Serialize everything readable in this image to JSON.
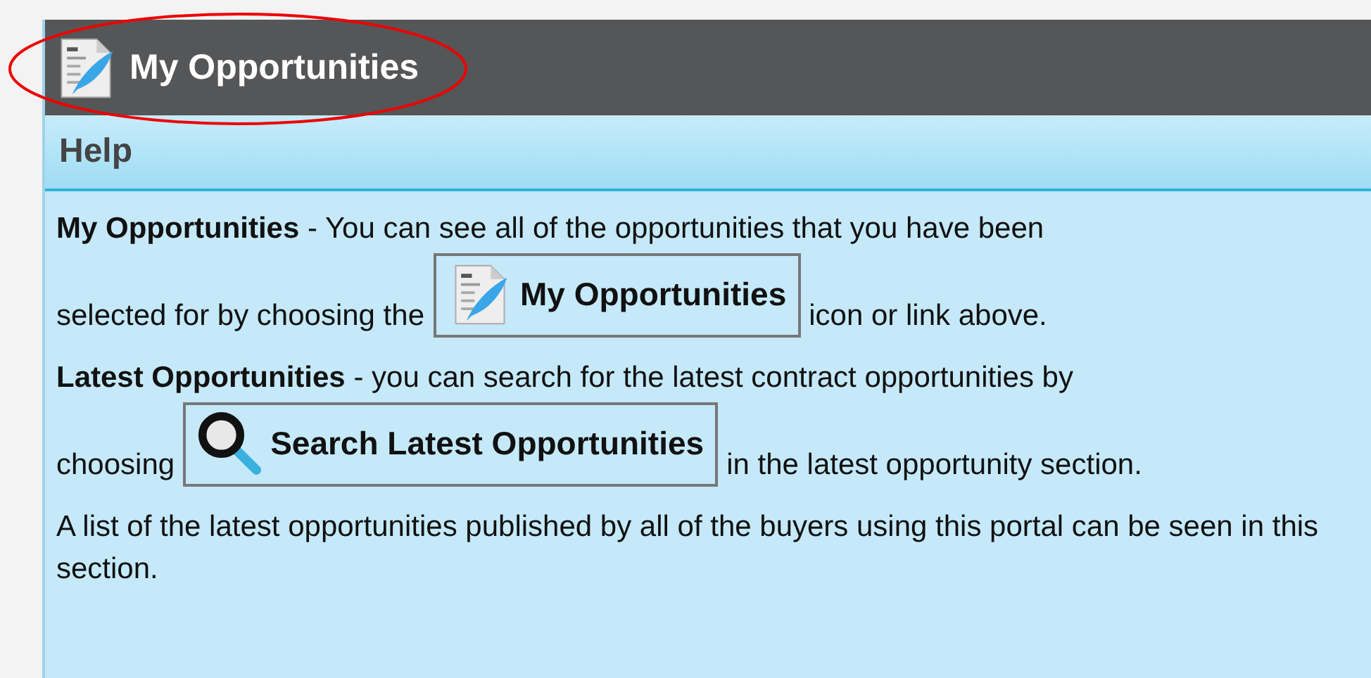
{
  "header": {
    "title": "My Opportunities",
    "highlighted": true
  },
  "help_bar": {
    "title": "Help"
  },
  "paragraphs": [
    {
      "kind": "with_button",
      "first_line": "**My Opportunities** - You can see all of the opportunities that you have been",
      "text_before": "selected for by choosing the",
      "button": {
        "label": "My Opportunities",
        "kind": "document"
      },
      "text_after": "icon or link above."
    },
    {
      "kind": "with_button",
      "first_line": "**Latest Opportunities** - you can search for the latest contract opportunities by",
      "text_before": "choosing",
      "button": {
        "label": "Search Latest Opportunities",
        "kind": "search"
      },
      "text_after": "in the latest opportunity section."
    },
    {
      "kind": "text",
      "text": "A list of the latest opportunities published by all of the buyers using this portal can be seen in this section."
    }
  ]
}
